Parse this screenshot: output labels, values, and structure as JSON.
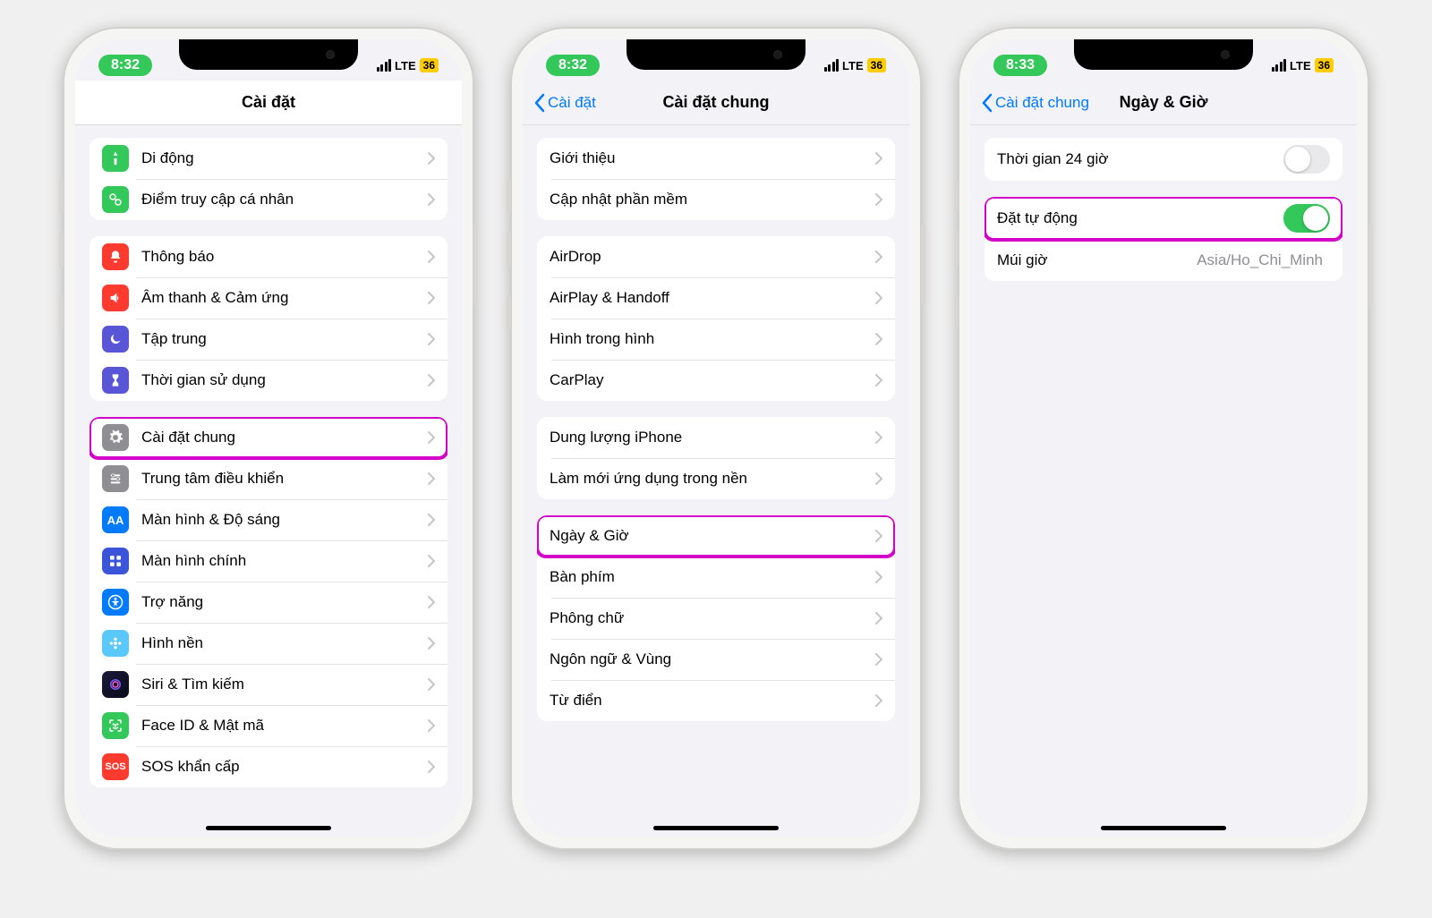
{
  "phones": [
    {
      "time": "8:32",
      "network": "LTE",
      "battery": "36",
      "nav": {
        "title": "Cài đặt",
        "back": null
      },
      "groups": [
        {
          "rows": [
            {
              "icon": {
                "bg": "bg-green",
                "glyph": "antenna"
              },
              "label": "Di động"
            },
            {
              "icon": {
                "bg": "bg-green",
                "glyph": "link"
              },
              "label": "Điểm truy cập cá nhân"
            }
          ]
        },
        {
          "rows": [
            {
              "icon": {
                "bg": "bg-red",
                "glyph": "bell"
              },
              "label": "Thông báo"
            },
            {
              "icon": {
                "bg": "bg-red",
                "glyph": "speaker"
              },
              "label": "Âm thanh & Cảm ứng"
            },
            {
              "icon": {
                "bg": "bg-indigo",
                "glyph": "moon"
              },
              "label": "Tập trung"
            },
            {
              "icon": {
                "bg": "bg-indigo",
                "glyph": "hourglass"
              },
              "label": "Thời gian sử dụng"
            }
          ]
        },
        {
          "rows": [
            {
              "icon": {
                "bg": "bg-gray",
                "glyph": "gear"
              },
              "label": "Cài đặt chung",
              "highlight": true
            },
            {
              "icon": {
                "bg": "bg-gray",
                "glyph": "switches"
              },
              "label": "Trung tâm điều khiển"
            },
            {
              "icon": {
                "bg": "bg-blue",
                "glyph": "aa"
              },
              "label": "Màn hình & Độ sáng"
            },
            {
              "icon": {
                "bg": "bg-blue",
                "glyph": "grid"
              },
              "label": "Màn hình chính"
            },
            {
              "icon": {
                "bg": "bg-blue",
                "glyph": "person"
              },
              "label": "Trợ năng"
            },
            {
              "icon": {
                "bg": "bg-teal",
                "glyph": "flower"
              },
              "label": "Hình nền"
            },
            {
              "icon": {
                "bg": "bg-black",
                "glyph": "siri"
              },
              "label": "Siri & Tìm kiếm"
            },
            {
              "icon": {
                "bg": "bg-green",
                "glyph": "faceid"
              },
              "label": "Face ID & Mật mã"
            },
            {
              "icon": {
                "bg": "bg-red",
                "glyph": "sos"
              },
              "label": "SOS khẩn cấp"
            }
          ]
        }
      ]
    },
    {
      "time": "8:32",
      "network": "LTE",
      "battery": "36",
      "nav": {
        "title": "Cài đặt chung",
        "back": "Cài đặt"
      },
      "groups": [
        {
          "rows": [
            {
              "label": "Giới thiệu"
            },
            {
              "label": "Cập nhật phần mềm"
            }
          ]
        },
        {
          "rows": [
            {
              "label": "AirDrop"
            },
            {
              "label": "AirPlay & Handoff"
            },
            {
              "label": "Hình trong hình"
            },
            {
              "label": "CarPlay"
            }
          ]
        },
        {
          "rows": [
            {
              "label": "Dung lượng iPhone"
            },
            {
              "label": "Làm mới ứng dụng trong nền"
            }
          ]
        },
        {
          "rows": [
            {
              "label": "Ngày & Giờ",
              "highlight": true
            },
            {
              "label": "Bàn phím"
            },
            {
              "label": "Phông chữ"
            },
            {
              "label": "Ngôn ngữ & Vùng"
            },
            {
              "label": "Từ điển"
            }
          ]
        }
      ]
    },
    {
      "time": "8:33",
      "network": "LTE",
      "battery": "36",
      "nav": {
        "title": "Ngày & Giờ",
        "back": "Cài đặt chung"
      },
      "groups": [
        {
          "rows": [
            {
              "label": "Thời gian 24 giờ",
              "toggle": "off"
            }
          ]
        },
        {
          "rows": [
            {
              "label": "Đặt tự động",
              "toggle": "on",
              "highlight": true
            },
            {
              "label": "Múi giờ",
              "detail": "Asia/Ho_Chi_Minh",
              "nochev": true
            }
          ]
        }
      ]
    }
  ],
  "icons_alt": {
    "antenna": "cellular-icon",
    "link": "hotspot-icon",
    "bell": "notifications-icon",
    "speaker": "sound-icon",
    "moon": "focus-icon",
    "hourglass": "screentime-icon",
    "gear": "general-icon",
    "switches": "control-center-icon",
    "aa": "display-icon",
    "grid": "home-screen-icon",
    "person": "accessibility-icon",
    "flower": "wallpaper-icon",
    "siri": "siri-icon",
    "faceid": "faceid-icon",
    "sos": "sos-icon"
  }
}
